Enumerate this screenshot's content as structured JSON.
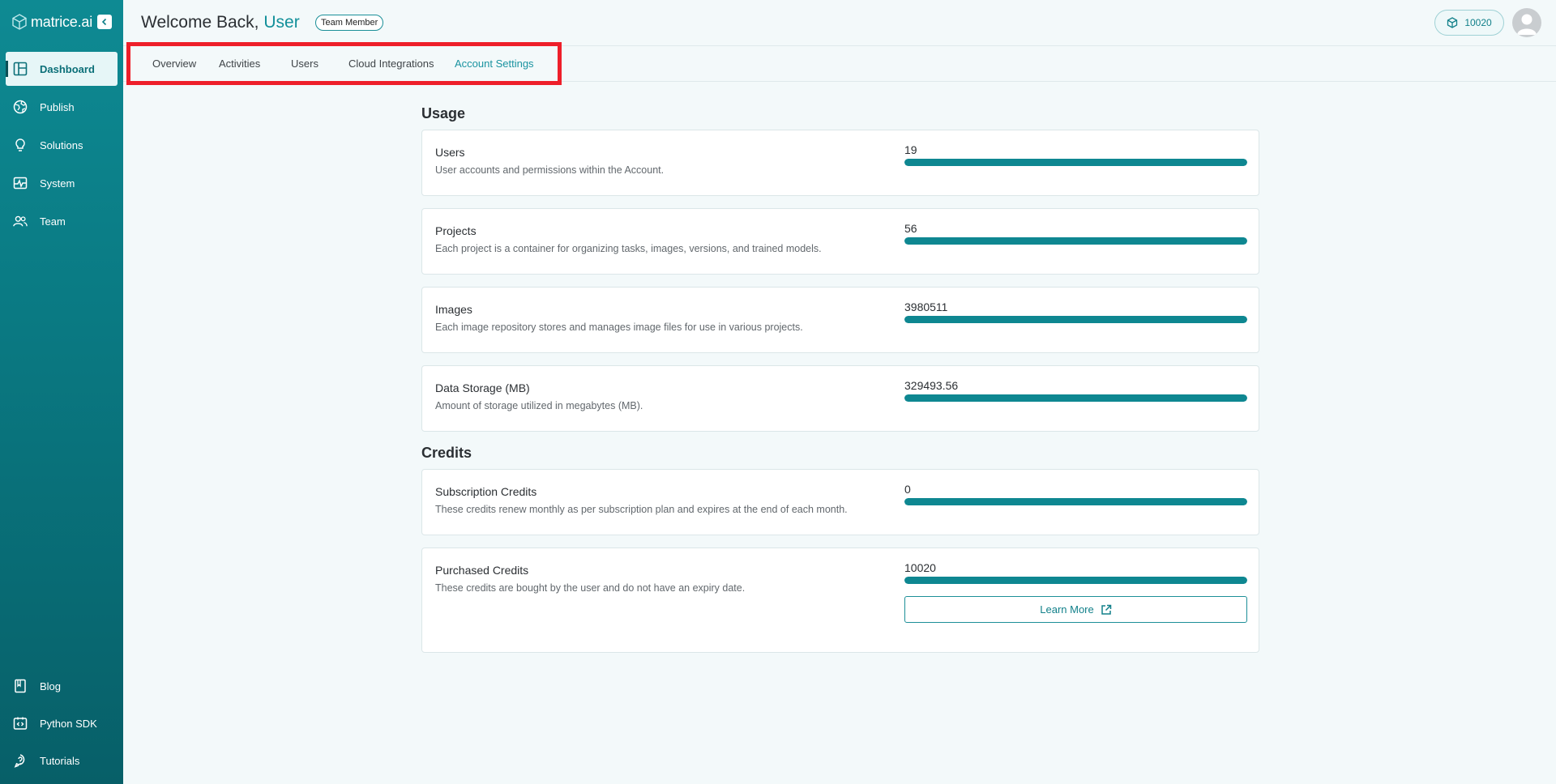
{
  "brand": {
    "name": "matrice.ai"
  },
  "sidebar": {
    "items": [
      {
        "label": "Dashboard",
        "icon": "dashboard-icon",
        "active": true
      },
      {
        "label": "Publish",
        "icon": "globe-icon"
      },
      {
        "label": "Solutions",
        "icon": "lightbulb-icon"
      },
      {
        "label": "System",
        "icon": "activity-icon"
      },
      {
        "label": "Team",
        "icon": "team-icon"
      }
    ],
    "bottom_items": [
      {
        "label": "Blog",
        "icon": "book-icon"
      },
      {
        "label": "Python SDK",
        "icon": "code-icon"
      },
      {
        "label": "Tutorials",
        "icon": "help-icon"
      }
    ]
  },
  "header": {
    "welcome_prefix": "Welcome Back,",
    "user_name": "User",
    "role": "Team Member",
    "credits": "10020"
  },
  "tabs": [
    {
      "label": "Overview"
    },
    {
      "label": "Activities"
    },
    {
      "label": "Users"
    },
    {
      "label": "Cloud Integrations"
    },
    {
      "label": "Account Settings",
      "active": true
    }
  ],
  "usage": {
    "title": "Usage",
    "items": [
      {
        "name": "Users",
        "description": "User accounts and permissions within the Account.",
        "value": "19",
        "fill": 1.0
      },
      {
        "name": "Projects",
        "description": "Each project is a container for organizing tasks, images, versions, and trained models.",
        "value": "56",
        "fill": 1.0
      },
      {
        "name": "Images",
        "description": "Each image repository stores and manages image files for use in various projects.",
        "value": "3980511",
        "fill": 1.0
      },
      {
        "name": "Data Storage (MB)",
        "description": "Amount of storage utilized in megabytes (MB).",
        "value": "329493.56",
        "fill": 1.0
      }
    ]
  },
  "credits": {
    "title": "Credits",
    "items": [
      {
        "name": "Subscription Credits",
        "description": "These credits renew monthly as per subscription plan and expires at the end of each month.",
        "value": "0",
        "fill": 1.0
      },
      {
        "name": "Purchased Credits",
        "description": "These credits are bought by the user and do not have an expiry date.",
        "value": "10020",
        "fill": 1.0
      }
    ],
    "learn_more": "Learn More"
  },
  "colors": {
    "accent": "#0e8791",
    "sidebar": "#0a7a83",
    "highlight": "#ee1f2a"
  }
}
